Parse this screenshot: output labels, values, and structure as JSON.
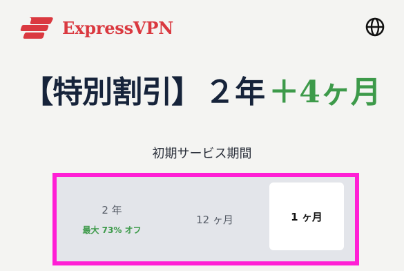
{
  "brand": {
    "name": "ExpressVPN",
    "color": "#da3940"
  },
  "header": {
    "language_icon": "globe-icon"
  },
  "headline": {
    "prefix": "【特別割引】",
    "years": "２年",
    "bonus": "＋4ヶ月",
    "bonus_color": "#3d9a4a"
  },
  "subtitle": "初期サービス期間",
  "plans": [
    {
      "label": "2 年",
      "sub": "最大 73% オフ",
      "selected": false
    },
    {
      "label": "12 ヶ月",
      "selected": false
    },
    {
      "label": "1 ヶ月",
      "selected": true
    }
  ],
  "highlight_color": "#ff1fd5"
}
